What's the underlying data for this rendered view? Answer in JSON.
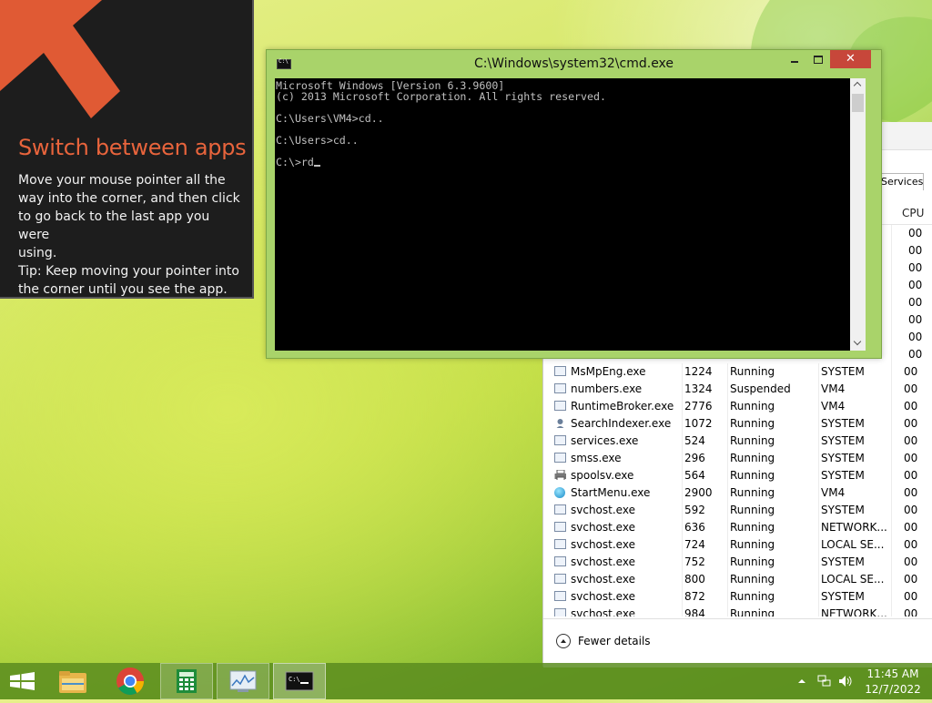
{
  "tip": {
    "title": "Switch between apps",
    "lines": [
      "Move your mouse pointer all the",
      "way into the corner, and then click",
      "to go back to the last app you were",
      "using.",
      "Tip: Keep moving your pointer into",
      "the corner until you see the app."
    ]
  },
  "cmd": {
    "title": "C:\\Windows\\system32\\cmd.exe",
    "close_label": "✕",
    "lines": [
      "Microsoft Windows [Version 6.3.9600]",
      "(c) 2013 Microsoft Corporation. All rights reserved.",
      "",
      "C:\\Users\\VM4>cd..",
      "",
      "C:\\Users>cd..",
      "",
      "C:\\>rd"
    ]
  },
  "taskmgr": {
    "tab_services": "Services",
    "col_cpu": "CPU",
    "hidden_cpu_values": [
      "00",
      "00",
      "00",
      "00",
      "00",
      "00",
      "00",
      "00"
    ],
    "rows": [
      {
        "icon": "window-icon",
        "name": "MsMpEng.exe",
        "pid": "1224",
        "status": "Running",
        "user": "SYSTEM",
        "cpu": "00"
      },
      {
        "icon": "window-icon",
        "name": "numbers.exe",
        "pid": "1324",
        "status": "Suspended",
        "user": "VM4",
        "cpu": "00"
      },
      {
        "icon": "window-icon",
        "name": "RuntimeBroker.exe",
        "pid": "2776",
        "status": "Running",
        "user": "VM4",
        "cpu": "00"
      },
      {
        "icon": "person-icon",
        "name": "SearchIndexer.exe",
        "pid": "1072",
        "status": "Running",
        "user": "SYSTEM",
        "cpu": "00"
      },
      {
        "icon": "window-icon",
        "name": "services.exe",
        "pid": "524",
        "status": "Running",
        "user": "SYSTEM",
        "cpu": "00"
      },
      {
        "icon": "window-icon",
        "name": "smss.exe",
        "pid": "296",
        "status": "Running",
        "user": "SYSTEM",
        "cpu": "00"
      },
      {
        "icon": "printer-icon",
        "name": "spoolsv.exe",
        "pid": "564",
        "status": "Running",
        "user": "SYSTEM",
        "cpu": "00"
      },
      {
        "icon": "globe-icon",
        "name": "StartMenu.exe",
        "pid": "2900",
        "status": "Running",
        "user": "VM4",
        "cpu": "00"
      },
      {
        "icon": "window-icon",
        "name": "svchost.exe",
        "pid": "592",
        "status": "Running",
        "user": "SYSTEM",
        "cpu": "00"
      },
      {
        "icon": "window-icon",
        "name": "svchost.exe",
        "pid": "636",
        "status": "Running",
        "user": "NETWORK...",
        "cpu": "00"
      },
      {
        "icon": "window-icon",
        "name": "svchost.exe",
        "pid": "724",
        "status": "Running",
        "user": "LOCAL SE...",
        "cpu": "00"
      },
      {
        "icon": "window-icon",
        "name": "svchost.exe",
        "pid": "752",
        "status": "Running",
        "user": "SYSTEM",
        "cpu": "00"
      },
      {
        "icon": "window-icon",
        "name": "svchost.exe",
        "pid": "800",
        "status": "Running",
        "user": "LOCAL SE...",
        "cpu": "00"
      },
      {
        "icon": "window-icon",
        "name": "svchost.exe",
        "pid": "872",
        "status": "Running",
        "user": "SYSTEM",
        "cpu": "00"
      },
      {
        "icon": "window-icon",
        "name": "svchost.exe",
        "pid": "984",
        "status": "Running",
        "user": "NETWORK...",
        "cpu": "00"
      }
    ],
    "fewer_details": "Fewer details"
  },
  "taskbar": {
    "items": [
      "start-icon",
      "file-explorer-icon",
      "chrome-icon",
      "calculator-icon",
      "resource-monitor-icon",
      "cmd-icon"
    ],
    "time": "11:45 AM",
    "date": "12/7/2022"
  },
  "colors": {
    "tip_title": "#e8643c",
    "close_button": "#c7473a",
    "window_frame": "#a9d36a"
  }
}
